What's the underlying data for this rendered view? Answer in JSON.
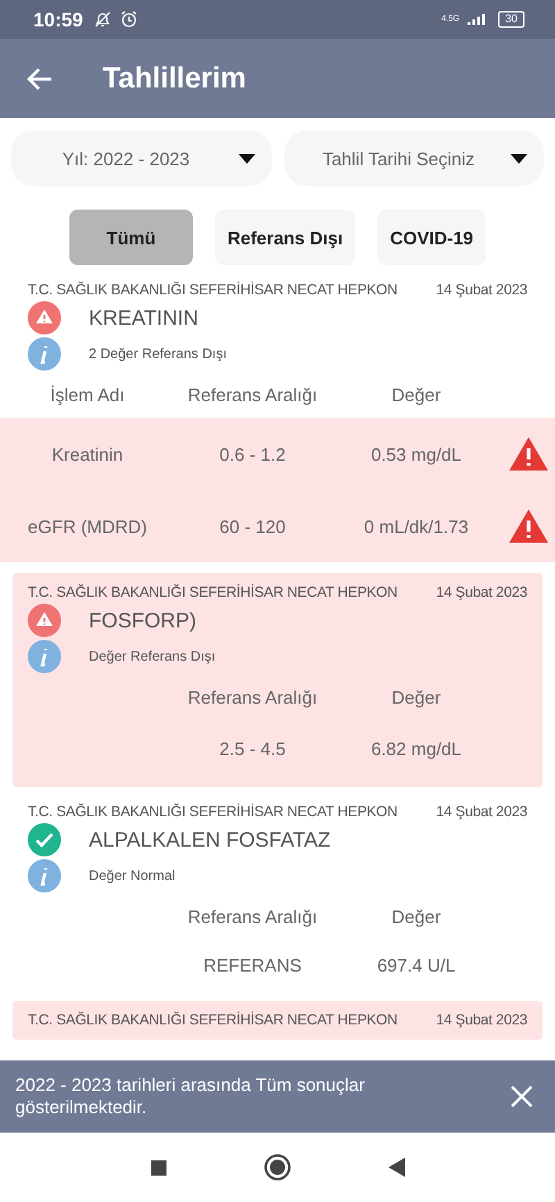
{
  "status_bar": {
    "time": "10:59",
    "network": "4.5G",
    "battery": "30"
  },
  "app_bar": {
    "title": "Tahlillerim"
  },
  "dropdowns": [
    {
      "value": "Yıl: 2022 - 2023"
    },
    {
      "value": "Tahlil Tarihi Seçiniz"
    }
  ],
  "filters": [
    {
      "label": "Tümü",
      "selected": true
    },
    {
      "label": "Referans Dışı",
      "selected": false
    },
    {
      "label": "COVID-19",
      "selected": false
    }
  ],
  "cards": [
    {
      "institution": "T.C. SAĞLIK BAKANLIĞI SEFERİHİSAR NECAT HEPKON",
      "date": "14 Şubat 2023",
      "out_of_range": true,
      "highlighted": false,
      "title": "KREATININ",
      "note": "2 Değer Referans Dışı",
      "columns": {
        "name": "İşlem Adı",
        "range": "Referans Aralığı",
        "value": "Değer"
      },
      "rows": [
        {
          "name": "Kreatinin",
          "range": "0.6 - 1.2",
          "value": "0.53 mg/dL",
          "flagged": true
        },
        {
          "name": "eGFR (MDRD)",
          "range": "60 - 120",
          "value": "0 mL/dk/1.73",
          "flagged": true
        }
      ]
    },
    {
      "institution": "T.C. SAĞLIK BAKANLIĞI SEFERİHİSAR NECAT HEPKON",
      "date": "14 Şubat 2023",
      "out_of_range": true,
      "highlighted": true,
      "title": "FOSFORP)",
      "note": "Değer Referans Dışı",
      "columns": {
        "range": "Referans Aralığı",
        "value": "Değer"
      },
      "rows": [
        {
          "range": "2.5 - 4.5",
          "value": "6.82 mg/dL",
          "flagged": false
        }
      ]
    },
    {
      "institution": "T.C. SAĞLIK BAKANLIĞI SEFERİHİSAR NECAT HEPKON",
      "date": "14 Şubat 2023",
      "out_of_range": false,
      "highlighted": false,
      "title": "ALPALKALEN FOSFATAZ",
      "note": "Değer Normal",
      "columns": {
        "range": "Referans Aralığı",
        "value": "Değer"
      },
      "rows": [
        {
          "range": "REFERANS",
          "value": "697.4 U/L",
          "flagged": false
        }
      ]
    },
    {
      "institution": "T.C. SAĞLIK BAKANLIĞI SEFERİHİSAR NECAT HEPKON",
      "date": "14 Şubat 2023",
      "highlighted": true
    }
  ],
  "snackbar": {
    "message": "2022 - 2023 tarihleri arasında Tüm sonuçlar gösterilmektedir."
  }
}
